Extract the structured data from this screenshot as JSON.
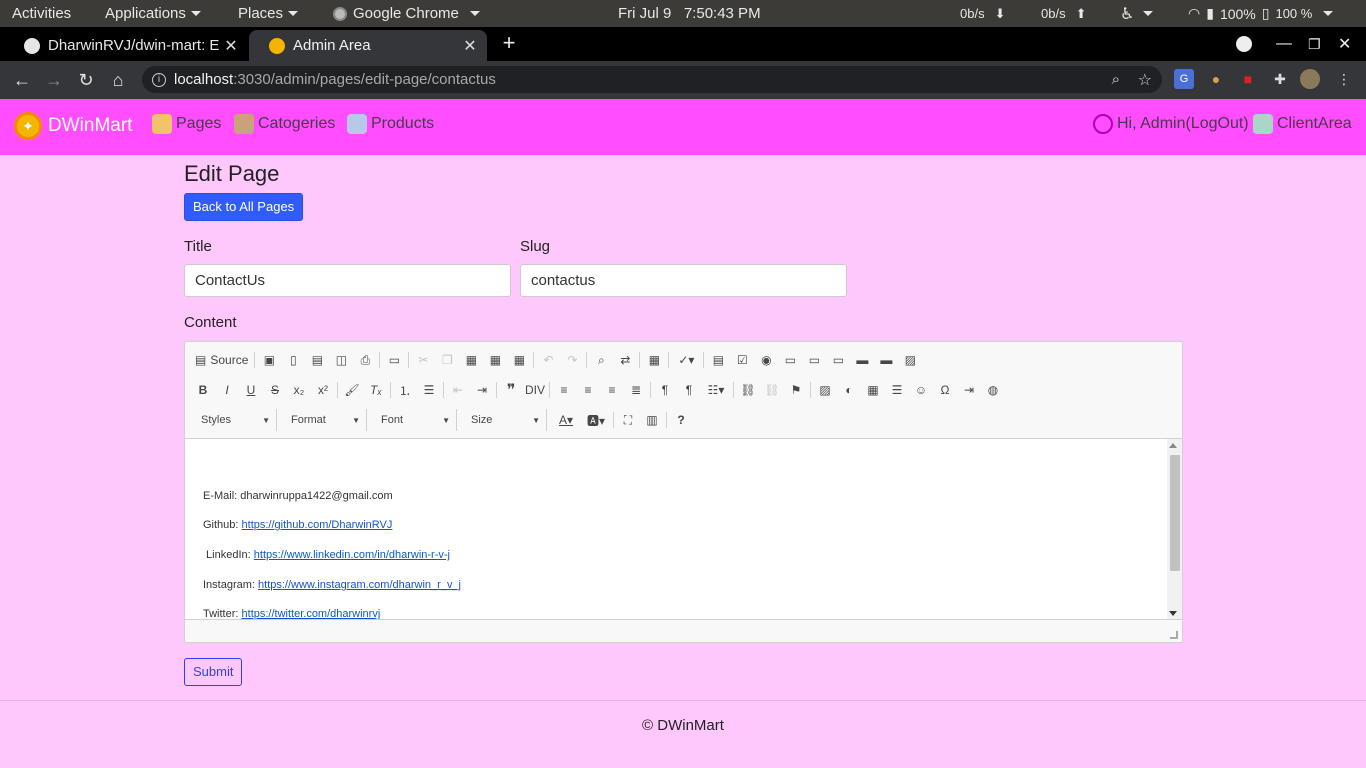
{
  "system_bar": {
    "activities": "Activities",
    "applications": "Applications",
    "places": "Places",
    "app_name": "Google Chrome",
    "clock": "Fri Jul 9   7:50:43 PM",
    "net_down": "0b/s",
    "net_up": "0b/s",
    "volume": "100%",
    "battery": "100 %"
  },
  "browser": {
    "tabs": [
      {
        "title": "DharwinRVJ/dwin-mart: E",
        "active": false
      },
      {
        "title": "Admin Area",
        "active": true
      }
    ],
    "url_host": "localhost",
    "url_path": ":3030/admin/pages/edit-page/contactus"
  },
  "site_nav": {
    "brand": "DWinMart",
    "links": [
      "Pages",
      "Catogeries",
      "Products"
    ],
    "user": "Hi, Admin(LogOut)",
    "client_area": "ClientArea"
  },
  "page": {
    "heading": "Edit Page",
    "back_button": "Back to All Pages",
    "title_label": "Title",
    "title_value": "ContactUs",
    "slug_label": "Slug",
    "slug_value": "contactus",
    "content_label": "Content",
    "submit": "Submit"
  },
  "editor": {
    "source_label": "Source",
    "styles": "Styles",
    "format": "Format",
    "font": "Font",
    "size": "Size",
    "content_lines": [
      {
        "prefix": "E-Mail: dharwinruppa1422@gmail.com",
        "link": ""
      },
      {
        "prefix": "Github: ",
        "link": "https://github.com/DharwinRVJ"
      },
      {
        "prefix": " LinkedIn: ",
        "link": "https://www.linkedin.com/in/dharwin-r-v-j"
      },
      {
        "prefix": "Instagram: ",
        "link": "https://www.instagram.com/dharwin_r_v_j"
      },
      {
        "prefix": "Twitter: ",
        "link": "https://twitter.com/dharwinrvj"
      }
    ]
  },
  "footer": {
    "text": "© DWinMart"
  }
}
